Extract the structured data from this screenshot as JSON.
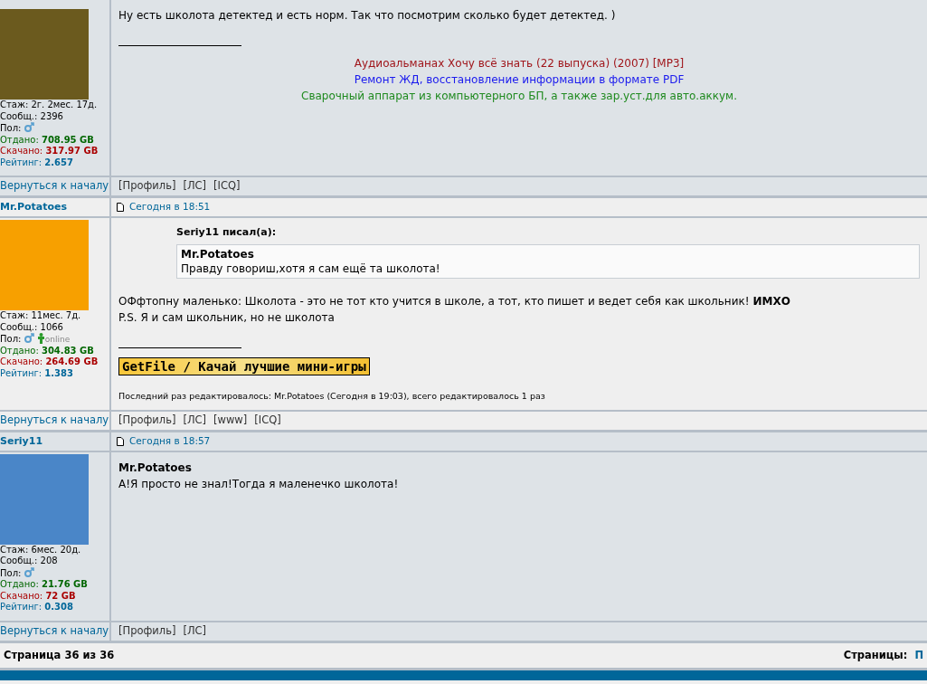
{
  "posts": [
    {
      "stats": [
        {
          "kind": "plain",
          "text": "Стаж: 2г. 2мес. 17д."
        },
        {
          "kind": "plain",
          "text": "Сообщ.: 2396"
        },
        {
          "kind": "gender",
          "text": "Пол:"
        },
        {
          "kind": "uploaded",
          "label": "Отдано:",
          "value": "708.95 GB"
        },
        {
          "kind": "downloaded",
          "label": "Скачано:",
          "value": "317.97 GB"
        },
        {
          "kind": "rating",
          "label": "Рейтинг:",
          "value": "2.657"
        }
      ],
      "body": [
        "Ну есть школота детектед и есть норм. Так что посмотрим сколько будет детектед. )"
      ],
      "signature": {
        "kind": "links",
        "items": [
          {
            "text": "Аудиоальманах Хочу всё знать (22 выпуска) (2007) [MP3]",
            "color": "#a0161b"
          },
          {
            "text": "Ремонт ЖД, восстановление информации в формате PDF",
            "color": "#1a1aee"
          },
          {
            "text": "Сварочный аппарат из компьютерного БП, а также зар.уст.для авто.аккум.",
            "color": "#1f8a1f"
          }
        ]
      },
      "back": "Вернуться к началу",
      "links": [
        "[Профиль]",
        "[ЛС]",
        "[ICQ]"
      ]
    },
    {
      "header": {
        "author": "Mr.Potatoes",
        "date": "Сегодня в 18:51"
      },
      "stats": [
        {
          "kind": "plain",
          "text": "Стаж: 11мес. 7д."
        },
        {
          "kind": "plain",
          "text": "Сообщ.: 1066"
        },
        {
          "kind": "gender",
          "text": "Пол:",
          "online": "online"
        },
        {
          "kind": "uploaded",
          "label": "Отдано:",
          "value": "304.83 GB"
        },
        {
          "kind": "downloaded",
          "label": "Скачано:",
          "value": "264.69 GB"
        },
        {
          "kind": "rating",
          "label": "Рейтинг:",
          "value": "1.383"
        }
      ],
      "quote": {
        "author": "Seriy11 писал(а):",
        "name": "Mr.Potatoes",
        "text": "Правду говориш,хотя я сам ещё та школота!"
      },
      "body": [
        "ОФфтопну маленько: Школота - это не тот кто учится в школе, а тот, кто пишет и ведет себя как школьник! **ИМХО**",
        "P.S. Я и сам школьник, но не школота"
      ],
      "signature": {
        "kind": "banner",
        "text": "GetFile / Качай лучшие мини-игры"
      },
      "edit_note": "Последний раз редактировалось: Mr.Potatoes (Сегодня в 19:03), всего редактировалось 1 раз",
      "back": "Вернуться к началу",
      "links": [
        "[Профиль]",
        "[ЛС]",
        "[www]",
        "[ICQ]"
      ]
    },
    {
      "header": {
        "author": "Seriy11",
        "date": "Сегодня в 18:57"
      },
      "stats": [
        {
          "kind": "plain",
          "text": "Стаж: 6мес. 20д."
        },
        {
          "kind": "plain",
          "text": "Сообщ.: 208"
        },
        {
          "kind": "gender",
          "text": "Пол:"
        },
        {
          "kind": "uploaded",
          "label": "Отдано:",
          "value": "21.76 GB"
        },
        {
          "kind": "downloaded",
          "label": "Скачано:",
          "value": "72 GB"
        },
        {
          "kind": "rating",
          "label": "Рейтинг:",
          "value": "0.308"
        }
      ],
      "recipient": "Mr.Potatoes",
      "body": [
        "А!Я просто не знал!Тогда я маленечко школота!"
      ],
      "back": "Вернуться к началу",
      "links": [
        "[Профиль]",
        "[ЛС]"
      ]
    }
  ],
  "pager": {
    "page": "Страница 36 из 36",
    "label": "Страницы:",
    "link": "П"
  }
}
